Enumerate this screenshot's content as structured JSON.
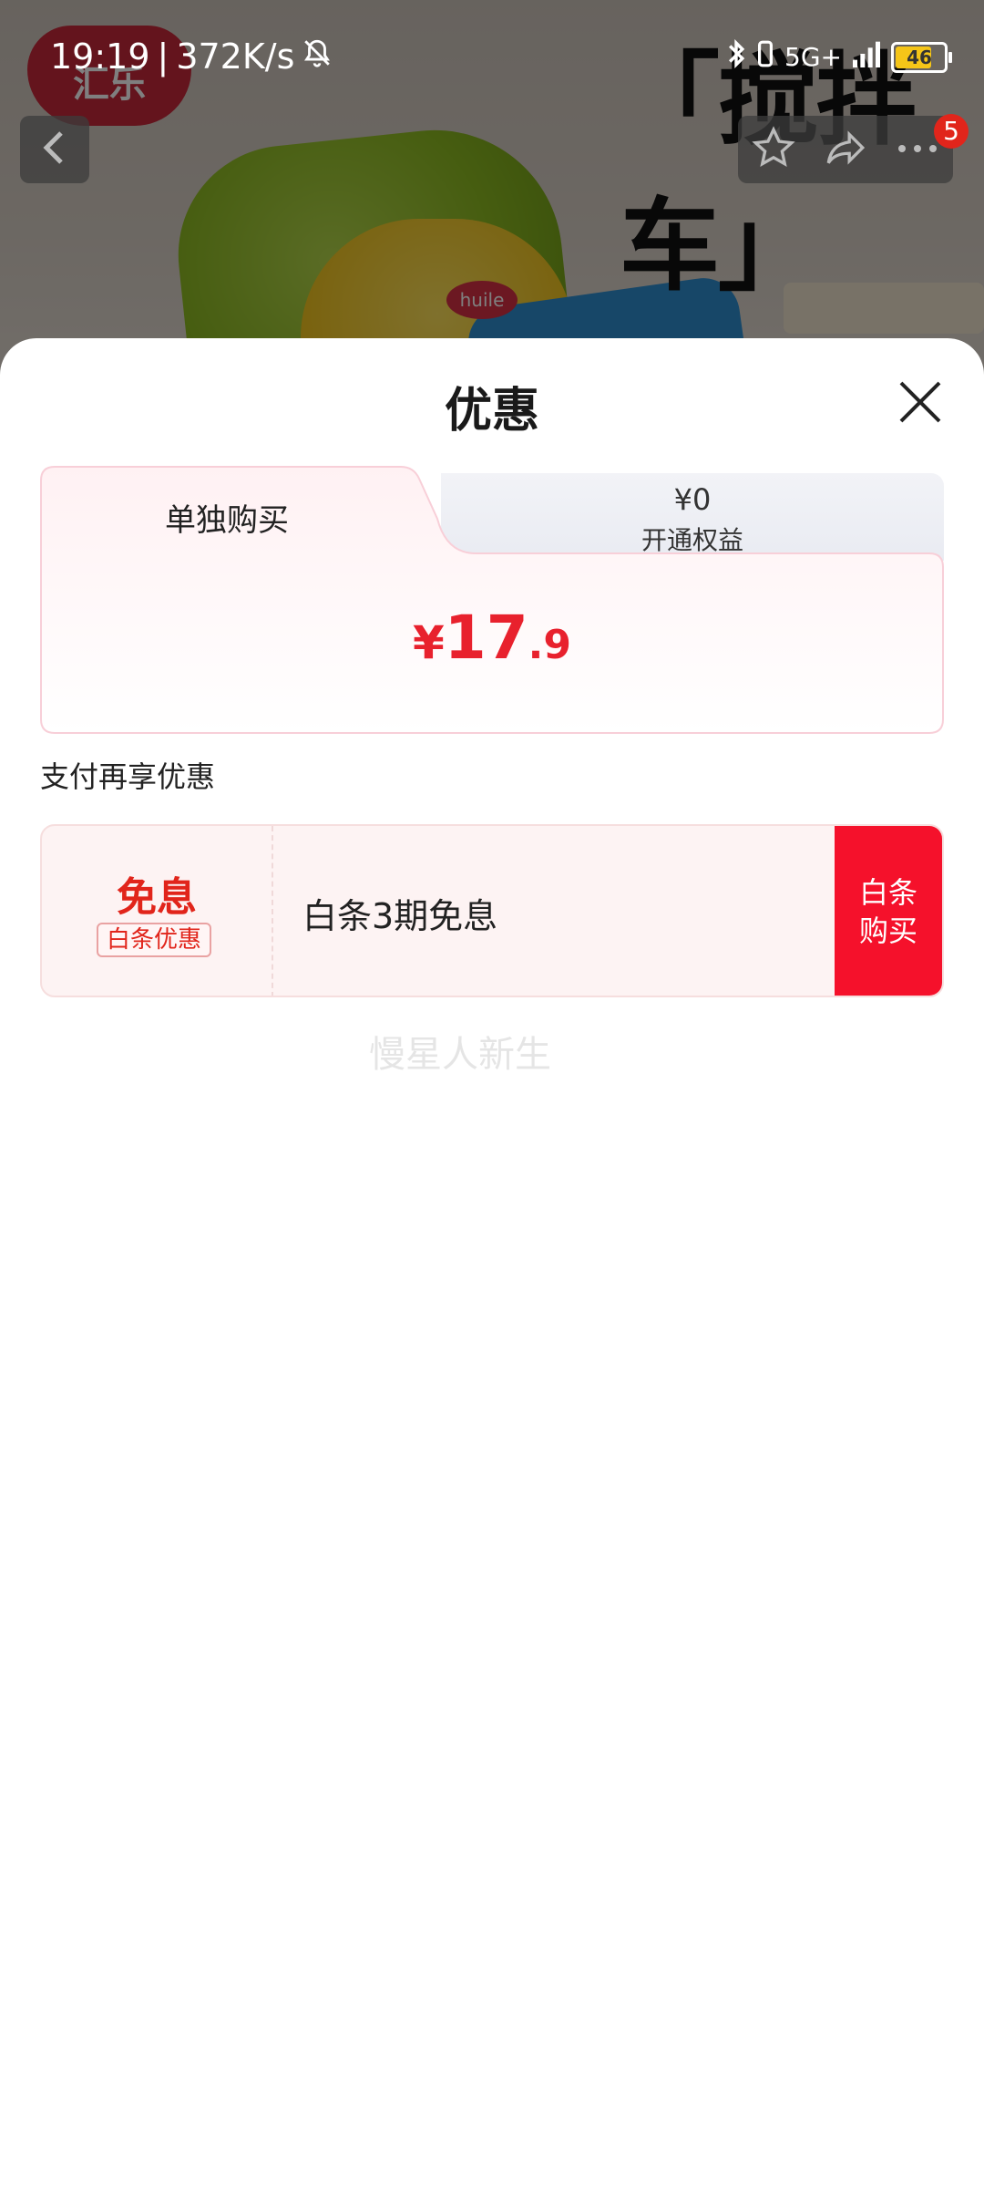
{
  "status_bar": {
    "time": "19:19",
    "speed": "372K/s",
    "network": "5G+",
    "battery": "46"
  },
  "background": {
    "brand": "汇乐",
    "product_title": "「搅拌车」",
    "toy_brand": "huile"
  },
  "nav": {
    "more_badge": "5"
  },
  "sheet": {
    "title": "优惠",
    "tabs": [
      {
        "label": "单独购买",
        "active": true
      },
      {
        "price": "¥0",
        "label": "开通权益",
        "active": false
      }
    ],
    "price": {
      "currency": "¥",
      "integer": "17",
      "decimal": ".9"
    },
    "section_label": "支付再享优惠",
    "coupon": {
      "title": "免息",
      "tag": "白条优惠",
      "description": "白条3期免息",
      "button": "白条购买"
    },
    "watermark": "慢星人新生"
  },
  "colors": {
    "accent_red": "#e8212d",
    "button_red": "#f5112b",
    "coupon_bg": "#fdf3f3"
  }
}
